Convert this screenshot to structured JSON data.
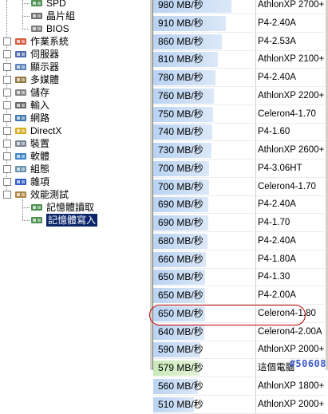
{
  "tree": {
    "items": [
      {
        "label": "SPD",
        "icon": "memory-chip-icon",
        "expand": ""
      },
      {
        "label": "晶片組",
        "icon": "chipset-icon",
        "expand": ""
      },
      {
        "label": "BIOS",
        "icon": "bios-chip-icon",
        "expand": ""
      },
      {
        "label": "作業系統",
        "icon": "windows-icon",
        "expand": "+"
      },
      {
        "label": "伺服器",
        "icon": "server-icon",
        "expand": "+"
      },
      {
        "label": "顯示器",
        "icon": "monitor-icon",
        "expand": "+"
      },
      {
        "label": "多媒體",
        "icon": "speaker-icon",
        "expand": "+"
      },
      {
        "label": "儲存",
        "icon": "storage-icon",
        "expand": "+"
      },
      {
        "label": "輸入",
        "icon": "keyboard-icon",
        "expand": "+"
      },
      {
        "label": "網路",
        "icon": "network-icon",
        "expand": "+"
      },
      {
        "label": "DirectX",
        "icon": "directx-icon",
        "expand": "+"
      },
      {
        "label": "裝置",
        "icon": "devices-icon",
        "expand": "+"
      },
      {
        "label": "軟體",
        "icon": "software-icon",
        "expand": "+"
      },
      {
        "label": "組態",
        "icon": "config-icon",
        "expand": "+"
      },
      {
        "label": "雜項",
        "icon": "misc-icon",
        "expand": "+"
      },
      {
        "label": "效能測試",
        "icon": "hourglass-icon",
        "expand": "−"
      },
      {
        "label": "記憶體讀取",
        "icon": "memory-read-icon",
        "expand": ""
      },
      {
        "label": "記憶體寫入",
        "icon": "memory-write-icon",
        "expand": "",
        "selected": true
      }
    ]
  },
  "list": {
    "rows": [
      {
        "value": "980 MB/秒",
        "mbps": 980,
        "cpu": "AthlonXP 2700+"
      },
      {
        "value": "910 MB/秒",
        "mbps": 910,
        "cpu": "P4-2.40A"
      },
      {
        "value": "860 MB/秒",
        "mbps": 860,
        "cpu": "P4-2.53A"
      },
      {
        "value": "810 MB/秒",
        "mbps": 810,
        "cpu": "AthlonXP 2100+"
      },
      {
        "value": "780 MB/秒",
        "mbps": 780,
        "cpu": "P4-2.40A"
      },
      {
        "value": "760 MB/秒",
        "mbps": 760,
        "cpu": "AthlonXP 2200+"
      },
      {
        "value": "750 MB/秒",
        "mbps": 750,
        "cpu": "Celeron4-1.70"
      },
      {
        "value": "740 MB/秒",
        "mbps": 740,
        "cpu": "P4-1.60"
      },
      {
        "value": "730 MB/秒",
        "mbps": 730,
        "cpu": "AthlonXP 2600+"
      },
      {
        "value": "700 MB/秒",
        "mbps": 700,
        "cpu": "P4-3.06HT"
      },
      {
        "value": "700 MB/秒",
        "mbps": 700,
        "cpu": "Celeron4-1.70"
      },
      {
        "value": "690 MB/秒",
        "mbps": 690,
        "cpu": "P4-2.40A"
      },
      {
        "value": "690 MB/秒",
        "mbps": 690,
        "cpu": "P4-1.70"
      },
      {
        "value": "680 MB/秒",
        "mbps": 680,
        "cpu": "P4-2.40A"
      },
      {
        "value": "660 MB/秒",
        "mbps": 660,
        "cpu": "P4-1.80A"
      },
      {
        "value": "650 MB/秒",
        "mbps": 650,
        "cpu": "P4-1.30"
      },
      {
        "value": "650 MB/秒",
        "mbps": 650,
        "cpu": "P4-2.00A"
      },
      {
        "value": "650 MB/秒",
        "mbps": 650,
        "cpu": "Celeron4-1.80"
      },
      {
        "value": "640 MB/秒",
        "mbps": 640,
        "cpu": "Celeron4-2.00A"
      },
      {
        "value": "590 MB/秒",
        "mbps": 590,
        "cpu": "AthlonXP 2000+"
      },
      {
        "value": "579 MB/秒",
        "mbps": 579,
        "cpu": "這個電腦",
        "highlight": true
      },
      {
        "value": "560 MB/秒",
        "mbps": 560,
        "cpu": "AthlonXP 1800+"
      },
      {
        "value": "510 MB/秒",
        "mbps": 510,
        "cpu": "AthlonXP 2000+"
      }
    ]
  },
  "colors": {
    "highlight_circle": "#c00000",
    "selection": "#0a246a",
    "bar": "#b9d3f2"
  },
  "watermark": "#50608"
}
